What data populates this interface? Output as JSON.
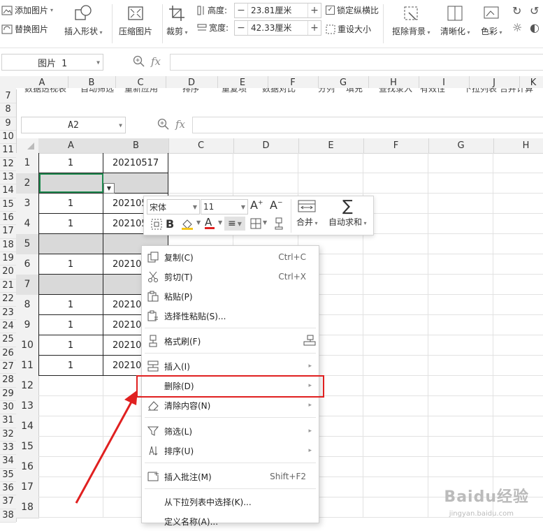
{
  "ribbon": {
    "add_picture": "添加图片",
    "replace_picture": "替换图片",
    "insert_shape": "插入形状",
    "compress_picture": "压缩图片",
    "crop": "裁剪",
    "height_label": "高度:",
    "height_value": "23.81厘米",
    "width_label": "宽度:",
    "width_value": "42.33厘米",
    "lock_ratio": "锁定纵横比",
    "reset_size": "重设大小",
    "remove_bg": "抠除背景",
    "sharpen": "清晰化",
    "color": "色彩"
  },
  "formula_bar_top": {
    "name": "图片 1",
    "fx": "fx"
  },
  "top_columns": [
    "A",
    "B",
    "C",
    "D",
    "E",
    "F",
    "G",
    "H",
    "I",
    "J",
    "K"
  ],
  "embedded_toolbar": [
    "数据透视表",
    "自动筛选",
    "重新应用",
    "排序",
    "重复项",
    "数据对比",
    "分列",
    "填充",
    "查找录入",
    "有效性",
    "下拉列表",
    "合并计算"
  ],
  "formula_bar_inner": {
    "name": "A2",
    "fx": "fx"
  },
  "columns": [
    "A",
    "B",
    "C",
    "D",
    "E",
    "F",
    "G",
    "H"
  ],
  "gutter_rows": [
    "7",
    "8",
    "9",
    "10",
    "11",
    "12",
    "13",
    "14",
    "15",
    "16",
    "17",
    "18",
    "19",
    "20",
    "21",
    "22",
    "23",
    "24",
    "25",
    "26",
    "27",
    "28",
    "29",
    "30",
    "31",
    "32",
    "33",
    "34",
    "35",
    "36",
    "37",
    "38"
  ],
  "rows": [
    {
      "num": "1",
      "a": "1",
      "b": "20210517"
    },
    {
      "num": "2",
      "a": "",
      "b": ""
    },
    {
      "num": "3",
      "a": "1",
      "b": "202105"
    },
    {
      "num": "4",
      "a": "1",
      "b": "202105"
    },
    {
      "num": "5",
      "a": "",
      "b": ""
    },
    {
      "num": "6",
      "a": "1",
      "b": "202105"
    },
    {
      "num": "7",
      "a": "",
      "b": ""
    },
    {
      "num": "8",
      "a": "1",
      "b": "202105"
    },
    {
      "num": "9",
      "a": "1",
      "b": "202105"
    },
    {
      "num": "10",
      "a": "1",
      "b": "202105"
    },
    {
      "num": "11",
      "a": "1",
      "b": "202105"
    },
    {
      "num": "12",
      "a": "",
      "b": ""
    },
    {
      "num": "13",
      "a": "",
      "b": ""
    },
    {
      "num": "14",
      "a": "",
      "b": ""
    },
    {
      "num": "15",
      "a": "",
      "b": ""
    },
    {
      "num": "16",
      "a": "",
      "b": ""
    },
    {
      "num": "17",
      "a": "",
      "b": ""
    },
    {
      "num": "18",
      "a": "",
      "b": ""
    }
  ],
  "mini_toolbar": {
    "font": "宋体",
    "size": "11",
    "merge": "合并",
    "autosum": "自动求和",
    "underline_color": "#e02020",
    "fill_color": "#f5c518"
  },
  "context_menu": {
    "copy": {
      "label": "复制(C)",
      "shortcut": "Ctrl+C"
    },
    "cut": {
      "label": "剪切(T)",
      "shortcut": "Ctrl+X"
    },
    "paste": {
      "label": "粘贴(P)"
    },
    "paste_special": {
      "label": "选择性粘贴(S)..."
    },
    "format_painter": {
      "label": "格式刷(F)"
    },
    "insert": {
      "label": "插入(I)"
    },
    "delete": {
      "label": "删除(D)"
    },
    "clear": {
      "label": "清除内容(N)"
    },
    "filter": {
      "label": "筛选(L)"
    },
    "sort": {
      "label": "排序(U)"
    },
    "comment": {
      "label": "插入批注(M)",
      "shortcut": "Shift+F2"
    },
    "pick_list": {
      "label": "从下拉列表中选择(K)..."
    },
    "define_name": {
      "label": "定义名称(A)..."
    }
  },
  "annotation_color": "#e02020",
  "watermark": {
    "text": "Baidu经验",
    "sub": "jingyan.baidu.com"
  }
}
